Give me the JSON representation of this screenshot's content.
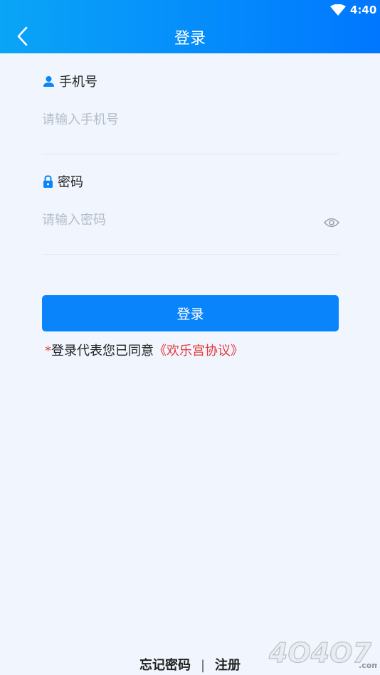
{
  "status_bar": {
    "time": "4:40",
    "wifi_icon": "wifi-icon"
  },
  "header": {
    "title": "登录",
    "back_icon": "chevron-left-icon"
  },
  "phone": {
    "label": "手机号",
    "placeholder": "请输入手机号",
    "value": "",
    "icon": "user-icon"
  },
  "password": {
    "label": "密码",
    "placeholder": "请输入密码",
    "value": "",
    "icon": "lock-icon",
    "toggle_icon": "eye-icon"
  },
  "login_button": {
    "label": "登录"
  },
  "agreement": {
    "star": "*",
    "text": "登录代表您已同意",
    "link": "《欢乐宫协议》"
  },
  "footer": {
    "forgot": "忘记密码",
    "separator": "|",
    "register": "注册"
  },
  "watermark": {
    "text": "4O4O7",
    "domain": ".com"
  },
  "colors": {
    "header_start": "#0aa5f7",
    "header_end": "#0077ff",
    "primary": "#0a84fb",
    "accent_red": "#e23a3a",
    "background": "#f1f6fe"
  }
}
